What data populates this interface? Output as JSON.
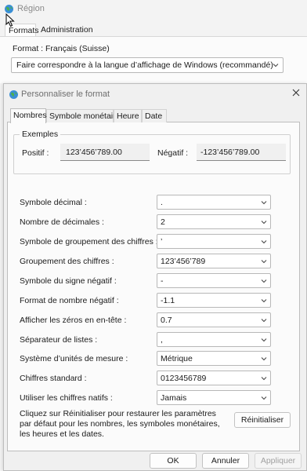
{
  "outer": {
    "title": "Région",
    "tabs": [
      "Formats",
      "Administration"
    ],
    "format_label": "Format : Français (Suisse)",
    "format_select": "Faire correspondre à la langue d’affichage de Windows (recommandé)"
  },
  "dialog": {
    "title": "Personnaliser le format",
    "tabs": [
      "Nombres",
      "Symbole monétaire",
      "Heure",
      "Date"
    ],
    "active_tab": "Nombres",
    "examples": {
      "title": "Exemples",
      "positive_label": "Positif :",
      "positive_value": "123’456’789.00",
      "negative_label": "Négatif :",
      "negative_value": "-123’456’789.00"
    },
    "settings": [
      {
        "label": "Symbole décimal :",
        "value": "."
      },
      {
        "label": "Nombre de décimales :",
        "value": "2"
      },
      {
        "label": "Symbole de groupement des chiffres :",
        "value": "’"
      },
      {
        "label": "Groupement des chiffres :",
        "value": "123’456’789"
      },
      {
        "label": "Symbole du signe négatif :",
        "value": "-"
      },
      {
        "label": "Format de nombre négatif :",
        "value": "-1.1"
      },
      {
        "label": "Afficher les zéros en en-tête :",
        "value": "0.7"
      },
      {
        "label": "Séparateur de listes :",
        "value": ","
      },
      {
        "label": "Système d’unités de mesure :",
        "value": "Métrique"
      },
      {
        "label": "Chiffres standard :",
        "value": "0123456789"
      },
      {
        "label": "Utiliser les chiffres natifs :",
        "value": "Jamais"
      }
    ],
    "reset_text": "Cliquez sur Réinitialiser pour restaurer les paramètres par défaut pour les nombres, les symboles monétaires, les heures et les dates.",
    "reset_button": "Réinitialiser",
    "buttons": {
      "ok": "OK",
      "cancel": "Annuler",
      "apply": "Appliquer"
    }
  },
  "icons": {
    "window_icon": "globe-icon",
    "close": "close-icon",
    "dropdown": "chevron-down-icon",
    "cursor": "mouse-pointer-icon"
  },
  "colors": {
    "window_bg": "#f3f3f3",
    "panel_bg": "#fbfbfb",
    "disabled_text": "#a0a0a0"
  }
}
